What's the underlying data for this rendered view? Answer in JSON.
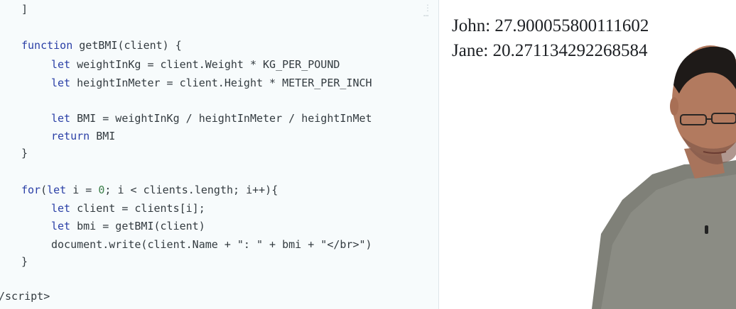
{
  "editor": {
    "lines": [
      {
        "indent": "",
        "text": "]"
      },
      {
        "indent": "",
        "text": ""
      },
      {
        "indent": "",
        "kw": "function",
        "text": " getBMI(client) {"
      },
      {
        "indent": "    ",
        "kw": "let",
        "text": " weightInKg = client.Weight * KG_PER_POUND"
      },
      {
        "indent": "    ",
        "kw": "let",
        "text": " heightInMeter = client.Height * METER_PER_INCH"
      },
      {
        "indent": "",
        "text": ""
      },
      {
        "indent": "    ",
        "kw": "let",
        "text": " BMI = weightInKg / heightInMeter / heightInMet"
      },
      {
        "indent": "    ",
        "kw": "return",
        "text": " BMI"
      },
      {
        "indent": "",
        "text": "}"
      },
      {
        "indent": "",
        "text": ""
      },
      {
        "indent": "",
        "kw": "for",
        "text": "(let i = 0; i < clients.length; i++){"
      },
      {
        "indent": "    ",
        "kw": "let",
        "text": " client = clients[i];"
      },
      {
        "indent": "    ",
        "kw": "let",
        "text": " bmi = getBMI(client)"
      },
      {
        "indent": "    ",
        "text": "document.write(client.Name + \": \" + bmi + \"</br>\")"
      },
      {
        "indent": "",
        "text": "}"
      },
      {
        "indent": "",
        "text": ""
      },
      {
        "indent": "",
        "text": "/script>"
      }
    ]
  },
  "output": {
    "lines": [
      "John: 27.900055800111602",
      "Jane: 20.271134292268584"
    ]
  },
  "colors": {
    "editor_bg": "#f7fbfc",
    "keyword": "#2a3fa6",
    "text": "#333b40",
    "output_text": "#1c1f23"
  },
  "icons": {
    "scroll_marker": "editor-scroll-marker-icon"
  }
}
